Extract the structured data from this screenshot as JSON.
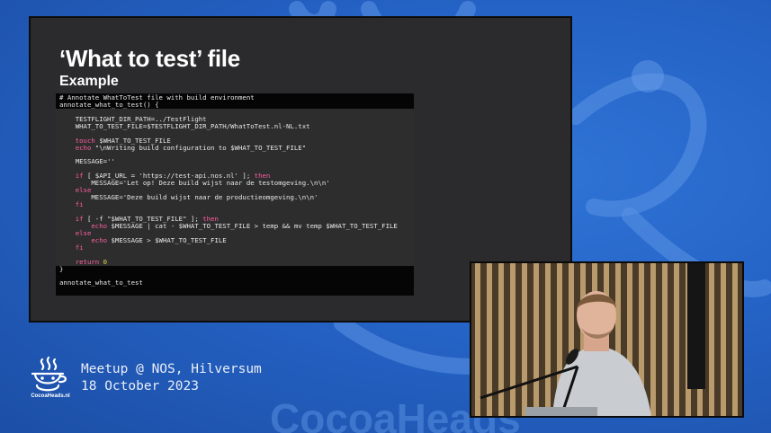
{
  "slide": {
    "title": "‘What to test’ file",
    "subtitle": "Example",
    "code_lines": [
      {
        "text": "# Annotate WhatToTest file with build environment",
        "hl": false
      },
      {
        "text": "annotate_what_to_test() {",
        "hl": false
      },
      {
        "text": "",
        "hl": true
      },
      {
        "text": "    TESTFLIGHT_DIR_PATH=../TestFlight",
        "hl": true
      },
      {
        "text": "    WHAT_TO_TEST_FILE=$TESTFLIGHT_DIR_PATH/WhatToTest.nl-NL.txt",
        "hl": true
      },
      {
        "text": "",
        "hl": true
      },
      {
        "text": "    touch $WHAT_TO_TEST_FILE",
        "hl": true
      },
      {
        "text": "    echo \"\\nWriting build configuration to $WHAT_TO_TEST_FILE\"",
        "hl": true
      },
      {
        "text": "",
        "hl": true
      },
      {
        "text": "    MESSAGE=''",
        "hl": true
      },
      {
        "text": "",
        "hl": true
      },
      {
        "text": "    if [ $API_URL = 'https://test-api.nos.nl' ]; then",
        "hl": true
      },
      {
        "text": "        MESSAGE='Let op! Deze build wijst naar de testomgeving.\\n\\n'",
        "hl": true
      },
      {
        "text": "    else",
        "hl": true
      },
      {
        "text": "        MESSAGE='Deze build wijst naar de productieomgeving.\\n\\n'",
        "hl": true
      },
      {
        "text": "    fi",
        "hl": true
      },
      {
        "text": "",
        "hl": true
      },
      {
        "text": "    if [ -f \"$WHAT_TO_TEST_FILE\" ]; then",
        "hl": true
      },
      {
        "text": "        echo $MESSAGE | cat - $WHAT_TO_TEST_FILE > temp && mv temp $WHAT_TO_TEST_FILE",
        "hl": true
      },
      {
        "text": "    else",
        "hl": true
      },
      {
        "text": "        echo $MESSAGE > $WHAT_TO_TEST_FILE",
        "hl": true
      },
      {
        "text": "    fi",
        "hl": true
      },
      {
        "text": "",
        "hl": true
      },
      {
        "text": "    return 0",
        "hl": true
      },
      {
        "text": "}",
        "hl": false
      },
      {
        "text": "",
        "hl": false
      },
      {
        "text": "annotate_what_to_test",
        "hl": false
      }
    ],
    "keywords": [
      "if",
      "then",
      "else",
      "fi",
      "echo",
      "return",
      "touch"
    ]
  },
  "footer": {
    "logo_icon": "cocoaheads-logo-icon",
    "logo_text": "CocoaHeads.nl",
    "event_line1": "Meetup @ NOS, Hilversum",
    "event_line2": "18 October 2023"
  },
  "webcam": {
    "icon": "speaker-video-feed"
  },
  "colors": {
    "background": "#2563c6",
    "slide_bg": "#2b2b2d",
    "code_bg": "#050505",
    "keyword": "#ff5fa2",
    "number": "#e8d44d"
  }
}
